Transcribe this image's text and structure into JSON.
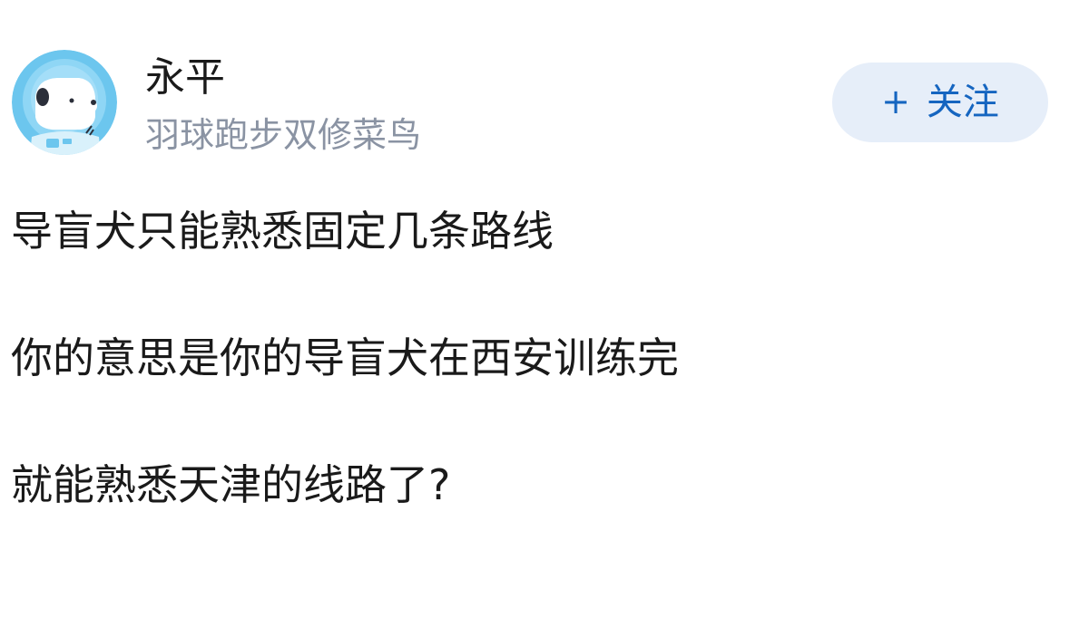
{
  "author": {
    "name": "永平",
    "bio": "羽球跑步双修菜鸟",
    "avatar_icon": "polar-bear-astronaut-avatar"
  },
  "follow_button": {
    "icon": "plus-icon",
    "plus_glyph": "+",
    "label": "关注",
    "text_color": "#1565c0",
    "bg_color": "#e6eef9"
  },
  "post": {
    "lines": [
      "导盲犬只能熟悉固定几条路线",
      "你的意思是你的导盲犬在西安训练完",
      "就能熟悉天津的线路了?"
    ]
  }
}
